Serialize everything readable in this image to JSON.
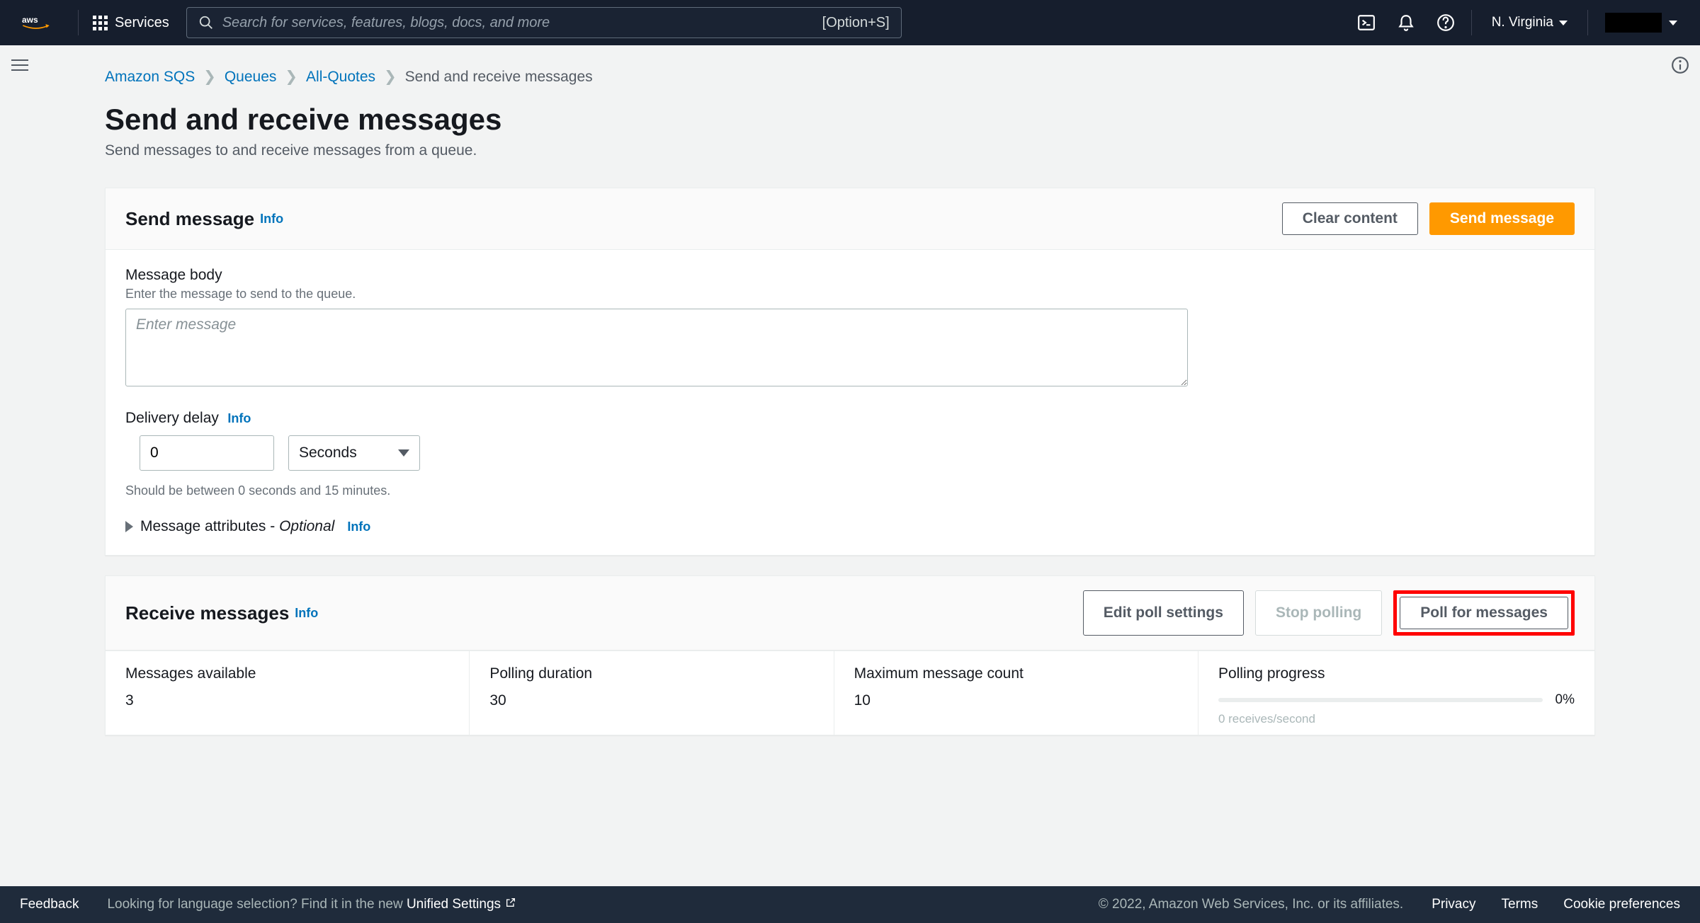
{
  "nav": {
    "services_label": "Services",
    "search_placeholder": "Search for services, features, blogs, docs, and more",
    "search_shortcut": "[Option+S]",
    "region": "N. Virginia"
  },
  "breadcrumbs": {
    "root": "Amazon SQS",
    "level1": "Queues",
    "level2": "All-Quotes",
    "current": "Send and receive messages"
  },
  "page": {
    "title": "Send and receive messages",
    "subtitle": "Send messages to and receive messages from a queue."
  },
  "send_panel": {
    "title": "Send message",
    "info": "Info",
    "clear_btn": "Clear content",
    "send_btn": "Send message",
    "body_label": "Message body",
    "body_hint": "Enter the message to send to the queue.",
    "body_placeholder": "Enter message",
    "delay_label": "Delivery delay",
    "delay_value": "0",
    "delay_unit": "Seconds",
    "delay_constraint": "Should be between 0 seconds and 15 minutes.",
    "attrs_label": "Message attributes - ",
    "attrs_optional": "Optional"
  },
  "receive_panel": {
    "title": "Receive messages",
    "info": "Info",
    "edit_btn": "Edit poll settings",
    "stop_btn": "Stop polling",
    "poll_btn": "Poll for messages",
    "stats": {
      "available_label": "Messages available",
      "available_value": "3",
      "duration_label": "Polling duration",
      "duration_value": "30",
      "max_label": "Maximum message count",
      "max_value": "10",
      "progress_label": "Polling progress",
      "progress_pct": "0%",
      "progress_sub": "0 receives/second"
    }
  },
  "footer": {
    "feedback": "Feedback",
    "lang_prompt": "Looking for language selection? Find it in the new ",
    "unified": "Unified Settings",
    "copyright": "© 2022, Amazon Web Services, Inc. or its affiliates.",
    "privacy": "Privacy",
    "terms": "Terms",
    "cookies": "Cookie preferences"
  }
}
